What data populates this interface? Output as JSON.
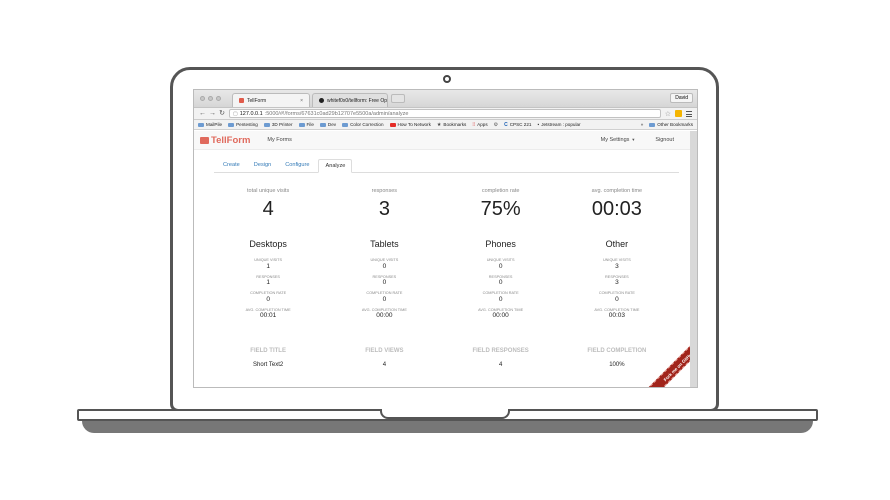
{
  "browser": {
    "tabs": [
      {
        "title": "TellForm"
      },
      {
        "title": "whitef0x0/tellform: Free Op"
      }
    ],
    "user": "David",
    "url_host": "127.0.0.1",
    "url_path": ":5000/#!/forms/67631c0ad29b12707e5500a/admin/analyze",
    "bookmarks": [
      {
        "label": "MailPile",
        "icon": "folder-icon"
      },
      {
        "label": "Pentesting",
        "icon": "folder-icon"
      },
      {
        "label": "3D Printer",
        "icon": "folder-icon"
      },
      {
        "label": "File",
        "icon": "folder-icon"
      },
      {
        "label": "Dev",
        "icon": "folder-icon"
      },
      {
        "label": "Color Correction",
        "icon": "folder-icon"
      },
      {
        "label": "How To Network",
        "icon": "youtube-icon"
      },
      {
        "label": "Bookmarks",
        "icon": "star-icon"
      },
      {
        "label": "Apps",
        "icon": "apps-icon"
      },
      {
        "label": "",
        "icon": "gear-icon"
      },
      {
        "label": "CPSC 221",
        "icon": "cs-icon"
      },
      {
        "label": "Jetstream : popular",
        "icon": "bookmark-icon"
      }
    ],
    "other_bookmarks": "Other Bookmarks",
    "overflow": "»"
  },
  "app": {
    "logo": "TellForm",
    "nav": {
      "my_forms": "My Forms",
      "my_settings": "My Settings",
      "signout": "Signout"
    },
    "tabs": [
      "Create",
      "Design",
      "Configure",
      "Analyze"
    ],
    "active_tab": "Analyze",
    "summary": [
      {
        "label": "total unique visits",
        "value": "4"
      },
      {
        "label": "responses",
        "value": "3"
      },
      {
        "label": "completion rate",
        "value": "75%"
      },
      {
        "label": "avg. completion time",
        "value": "00:03"
      }
    ],
    "metric_labels": [
      "UNIQUE VISITS",
      "RESPONSES",
      "COMPLETION RATE",
      "AVG. COMPLETION TIME"
    ],
    "devices": [
      {
        "name": "Desktops",
        "unique_visits": "1",
        "responses": "1",
        "completion_rate": "0",
        "avg_time": "00:01"
      },
      {
        "name": "Tablets",
        "unique_visits": "0",
        "responses": "0",
        "completion_rate": "0",
        "avg_time": "00:00"
      },
      {
        "name": "Phones",
        "unique_visits": "0",
        "responses": "0",
        "completion_rate": "0",
        "avg_time": "00:00"
      },
      {
        "name": "Other",
        "unique_visits": "3",
        "responses": "3",
        "completion_rate": "0",
        "avg_time": "00:03"
      }
    ],
    "field_table": {
      "headers": [
        "FIELD TITLE",
        "FIELD VIEWS",
        "FIELD RESPONSES",
        "FIELD COMPLETION"
      ],
      "rows": [
        [
          "Short Text2",
          "4",
          "4",
          "100%"
        ]
      ]
    },
    "ribbon": "Fork me on GitHub"
  },
  "colors": {
    "brand": "#e06a5d",
    "ribbon": "#a1241b",
    "link": "#337ab7"
  }
}
